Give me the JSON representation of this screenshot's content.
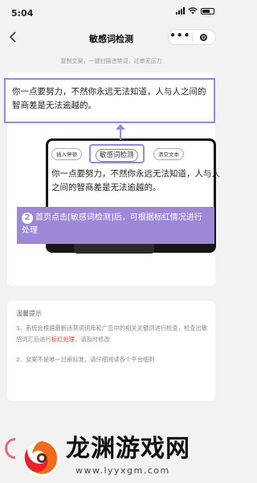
{
  "status": {
    "time": "5:04"
  },
  "nav": {
    "title": "敏感词检测",
    "back_icon": "chevron-left-icon",
    "more_icon": "more-dots-icon",
    "close_icon": "target-circle-icon"
  },
  "subtitle": "复制文案，一键扫描违禁词，过审无压力",
  "tutorial": {
    "callout_text": "你一点要努力，不然你永远无法知道，人与人之间的智商差是无法逾越的。",
    "buttons": {
      "insert": "插入停顿",
      "detect": "敏感词检测",
      "clear": "清空文本"
    },
    "inner_text": "你一点要努力，不然你永远无法知道，人与人之间的智商差是无法逾越的。",
    "step_number": "2",
    "step_text": "首页点击[敏感词检测]后，可根据标红情况进行处理",
    "accent_color": "#9b87d6"
  },
  "tips": {
    "title": "温馨提示",
    "item1_prefix": "1、系统会根据最新违禁词词库和广告中的相关关键词进行检查，检查出敏感词汇后进行",
    "item1_highlight": "标红处理",
    "item1_suffix": "，请及时修改",
    "item2": "2、文案不是唯一过审标准，请仔细阅读各个平台细则",
    "highlight_color": "#e0403a"
  },
  "watermark": {
    "title": "龙渊游戏网",
    "url": "www.lyyxgm.com"
  }
}
